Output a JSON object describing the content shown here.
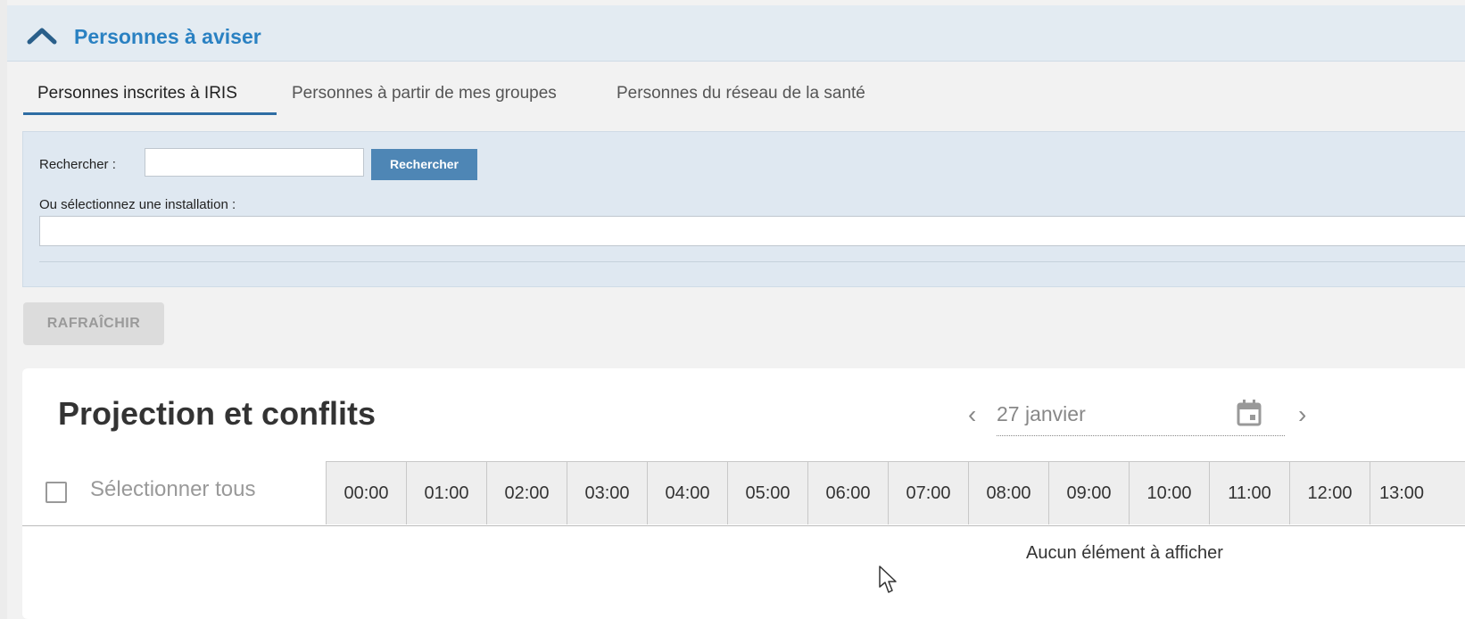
{
  "panel": {
    "title": "Personnes à aviser",
    "collapse_icon": "chevron-up-icon",
    "accent_color": "#2a81c2"
  },
  "tabs": [
    {
      "label": "Personnes inscrites à IRIS",
      "active": true
    },
    {
      "label": "Personnes à partir de mes groupes",
      "active": false
    },
    {
      "label": "Personnes du réseau de la santé",
      "active": false
    }
  ],
  "search": {
    "label": "Rechercher :",
    "value": "",
    "button_label": "Rechercher",
    "install_label": "Ou sélectionnez une installation :",
    "install_value": ""
  },
  "refresh_label": "RAFRAÎCHIR",
  "projection": {
    "title": "Projection et conflits",
    "date": "27 janvier",
    "prev_icon": "chevron-left-icon",
    "next_icon": "chevron-right-icon",
    "calendar_icon": "calendar-icon",
    "select_all_label": "Sélectionner tous",
    "select_all_checked": false,
    "hours": [
      "00:00",
      "01:00",
      "02:00",
      "03:00",
      "04:00",
      "05:00",
      "06:00",
      "07:00",
      "08:00",
      "09:00",
      "10:00",
      "11:00",
      "12:00",
      "13:00"
    ],
    "empty_message": "Aucun élément à afficher"
  }
}
